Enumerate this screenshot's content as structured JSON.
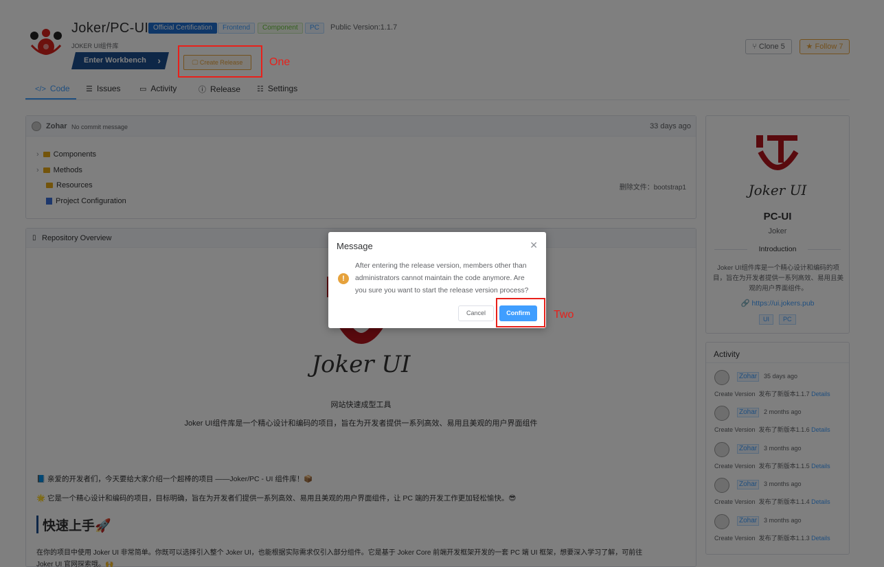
{
  "repo": {
    "title": "Joker/PC-UI",
    "subtitle": "JOKER UI组件库",
    "badges": {
      "official": "Official Certification",
      "frontend": "Frontend",
      "component": "Component",
      "pc": "PC"
    },
    "version": "Public Version:1.1.7"
  },
  "actions": {
    "workbench": "Enter Workbench",
    "create_release": "Create Release",
    "clone": "Clone 5",
    "follow": "Follow 7"
  },
  "annotations": {
    "one": "One",
    "two": "Two"
  },
  "tabs": [
    {
      "label": "Code",
      "icon": "code-icon"
    },
    {
      "label": "Issues",
      "icon": "list-icon"
    },
    {
      "label": "Activity",
      "icon": "activity-icon"
    },
    {
      "label": "Release",
      "icon": "release-icon"
    },
    {
      "label": "Settings",
      "icon": "settings-icon"
    }
  ],
  "commit": {
    "author": "Zohar",
    "message": "No commit message",
    "time": "33 days ago",
    "files": [
      {
        "name": "Components",
        "type": "folder"
      },
      {
        "name": "Methods",
        "type": "folder"
      },
      {
        "name": "Resources",
        "type": "folder",
        "note": "删除文件：bootstrap1"
      },
      {
        "name": "Project Configuration",
        "type": "file"
      }
    ]
  },
  "overview": {
    "header": "Repository Overview",
    "logo_text": "Joker UI",
    "tagline": "网站快速成型工具",
    "description": "Joker UI组件库是一个精心设计和编码的项目，旨在为开发者提供一系列高效、易用且美观的用户界面组件",
    "para1": "📘 亲爱的开发者们，今天要给大家介绍一个超棒的项目 ——Joker/PC - UI 组件库！📦",
    "para2": "🌟 它是一个精心设计和编码的项目，目标明确，旨在为开发者们提供一系列高效、易用且美观的用户界面组件，让 PC 端的开发工作更加轻松愉快。😎",
    "heading": "快速上手🚀",
    "para3a": "在你的项目中使用 Joker UI 非常简单。你既可以选择引入整个 Joker UI，也能根据实际需求仅引入部分组件。它是基于 Joker Core 前端开发框架开发的一套 PC 端 UI 框架，想要深入学习了解，可前往",
    "para3b": "Joker UI 官网探索哦。🙌"
  },
  "side": {
    "logo_text": "Joker UI",
    "name": "PC-UI",
    "owner": "Joker",
    "intro_label": "Introduction",
    "intro": "Joker UI组件库是一个精心设计和编码的项目，旨在为开发者提供一系列高效、易用且美观的用户界面组件。",
    "link": "https://ui.jokers.pub",
    "tags": [
      "UI",
      "PC"
    ]
  },
  "activity": {
    "title": "Activity",
    "items": [
      {
        "user": "Zohar",
        "time": "35 days ago",
        "action": "Create Version",
        "desc": "发布了新版本1.1.7",
        "link": "Details"
      },
      {
        "user": "Zohar",
        "time": "2 months ago",
        "action": "Create Version",
        "desc": "发布了新版本1.1.6",
        "link": "Details"
      },
      {
        "user": "Zohar",
        "time": "3 months ago",
        "action": "Create Version",
        "desc": "发布了新版本1.1.5",
        "link": "Details"
      },
      {
        "user": "Zohar",
        "time": "3 months ago",
        "action": "Create Version",
        "desc": "发布了新版本1.1.4",
        "link": "Details"
      },
      {
        "user": "Zohar",
        "time": "3 months ago",
        "action": "Create Version",
        "desc": "发布了新版本1.1.3",
        "link": "Details"
      }
    ]
  },
  "dialog": {
    "title": "Message",
    "message": "After entering the release version, members other than administrators cannot maintain the code anymore. Are you sure you want to start the release version process?",
    "cancel": "Cancel",
    "confirm": "Confirm"
  },
  "colors": {
    "primary": "#409eff",
    "warning": "#e6a23c",
    "annotation": "#e8201a",
    "brand_red": "#b3141c"
  }
}
